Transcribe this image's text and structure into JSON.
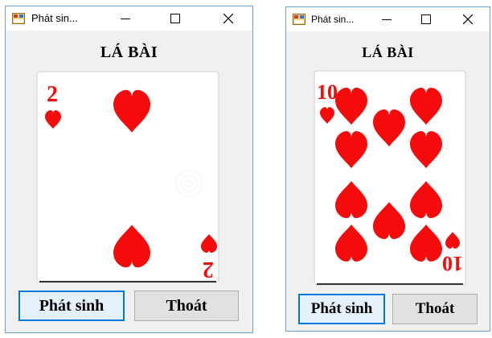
{
  "windows": [
    {
      "title": "Phát sin...",
      "heading": "LÁ BÀI",
      "card": {
        "rank": "2",
        "suit": "hearts",
        "suit_color": "#f50b0b"
      },
      "buttons": {
        "generate": "Phát sinh",
        "exit": "Thoát"
      }
    },
    {
      "title": "Phát sin...",
      "heading": "LÁ BÀI",
      "card": {
        "rank": "10",
        "suit": "hearts",
        "suit_color": "#f50b0b"
      },
      "buttons": {
        "generate": "Phát sinh",
        "exit": "Thoát"
      }
    }
  ],
  "title_controls": [
    "minimize-icon",
    "maximize-icon",
    "close-icon"
  ],
  "colors": {
    "focus_border": "#0078d7",
    "window_border": "#6d9fd1",
    "heart_red": "#f50b0b"
  }
}
